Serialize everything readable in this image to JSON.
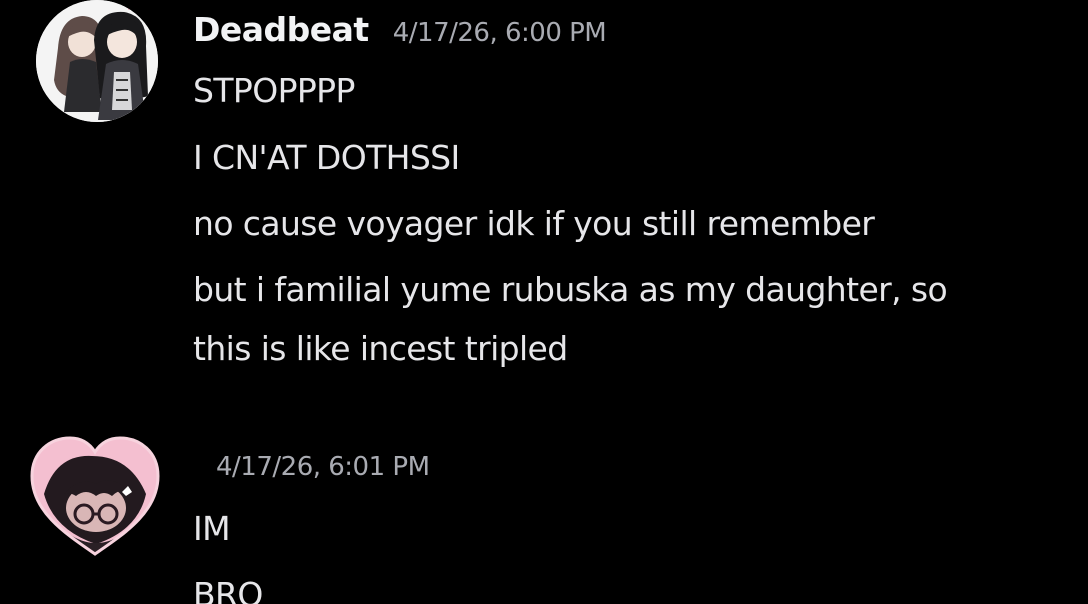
{
  "messages": [
    {
      "username": "Deadbeat",
      "timestamp": "4/17/26, 6:00 PM",
      "avatar_icon": "anime-duo-avatar",
      "lines": [
        "STPOPPPP",
        "I CN'AT DOTHSSI",
        "no cause voyager idk if you still remember",
        "but i familial yume rubuska as my daughter, so",
        "this is like incest tripled"
      ]
    },
    {
      "username": "",
      "timestamp": "4/17/26, 6:01 PM",
      "avatar_icon": "heart-frame-avatar",
      "lines": [
        "IM",
        "BRO"
      ]
    }
  ],
  "colors": {
    "background": "#000000",
    "text": "#e6e6e9",
    "username": "#f2f3f5",
    "timestamp": "#a9abb2",
    "heart_avatar": "#f4bfd0"
  }
}
